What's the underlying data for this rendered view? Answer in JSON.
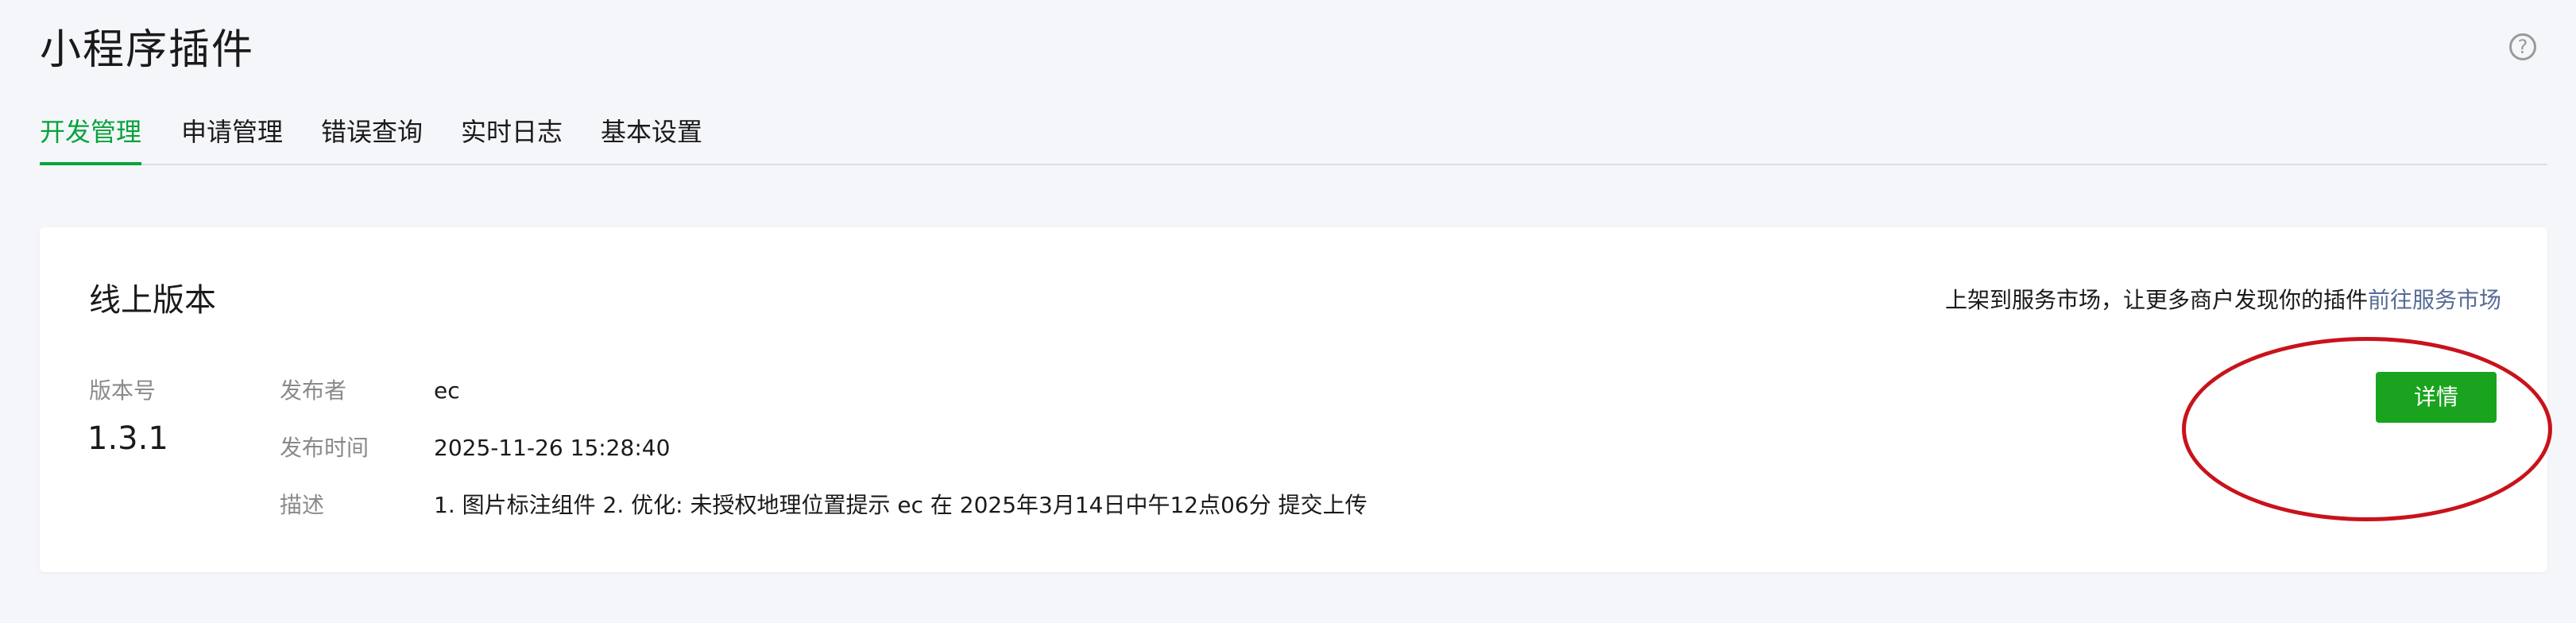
{
  "header": {
    "title": "小程序插件",
    "help_icon": "help-circle-icon",
    "help_glyph": "?"
  },
  "tabs": [
    {
      "label": "开发管理",
      "active": true
    },
    {
      "label": "申请管理",
      "active": false
    },
    {
      "label": "错误查询",
      "active": false
    },
    {
      "label": "实时日志",
      "active": false
    },
    {
      "label": "基本设置",
      "active": false
    }
  ],
  "online_version": {
    "title": "线上版本",
    "market_hint": "上架到服务市场，让更多商户发现你的插件",
    "market_link": "前往服务市场",
    "version_label": "版本号",
    "version_value": "1.3.1",
    "publisher_label": "发布者",
    "publisher_value": "ec",
    "publish_time_label": "发布时间",
    "publish_time_value": "2025-11-26 15:28:40",
    "description_label": "描述",
    "description_value": "1. 图片标注组件 2. 优化: 未授权地理位置提示 ec 在 2025年3月14日中午12点06分 提交上传",
    "detail_button": "详情"
  },
  "colors": {
    "accent_green": "#07a33b",
    "button_green": "#1aa31e",
    "link_blue": "#576b95",
    "annotation_red": "#c8131b",
    "background": "#f5f6fa"
  }
}
